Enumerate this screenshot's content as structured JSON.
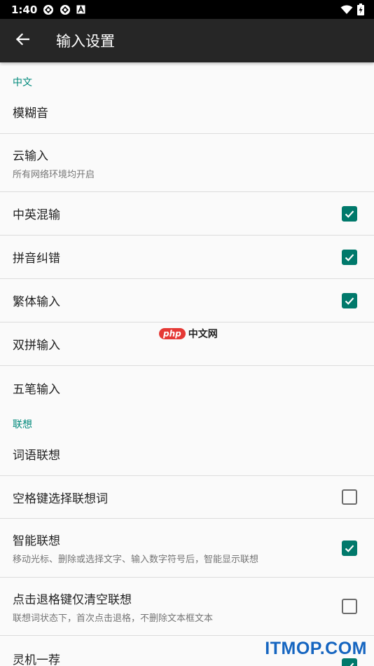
{
  "status_bar": {
    "time": "1:40",
    "icons": [
      "app-notification-icon",
      "app-notification-icon",
      "a-notification-icon",
      "wifi-icon",
      "battery-icon"
    ]
  },
  "app_bar": {
    "title": "输入设置",
    "back_icon": "arrow-back-icon"
  },
  "sections": [
    {
      "header": "中文",
      "items": [
        {
          "title": "模糊音",
          "summary": "",
          "checkbox": null
        },
        {
          "title": "云输入",
          "summary": "所有网络环境均开启",
          "checkbox": null
        },
        {
          "title": "中英混输",
          "summary": "",
          "checkbox": true
        },
        {
          "title": "拼音纠错",
          "summary": "",
          "checkbox": true
        },
        {
          "title": "繁体输入",
          "summary": "",
          "checkbox": true
        },
        {
          "title": "双拼输入",
          "summary": "",
          "checkbox": null
        },
        {
          "title": "五笔输入",
          "summary": "",
          "checkbox": null
        }
      ]
    },
    {
      "header": "联想",
      "items": [
        {
          "title": "词语联想",
          "summary": "",
          "checkbox": null
        },
        {
          "title": "空格键选择联想词",
          "summary": "",
          "checkbox": false
        },
        {
          "title": "智能联想",
          "summary": "移动光标、删除或选择文字、输入数字符号后，智能显示联想",
          "checkbox": true
        },
        {
          "title": "点击退格键仅清空联想",
          "summary": "联想词状态下，首次点击退格，不删除文本框文本",
          "checkbox": false
        },
        {
          "title": "灵机一荐",
          "summary": "",
          "checkbox": true
        }
      ]
    }
  ],
  "watermark": {
    "badge": "php",
    "text": "中文网"
  },
  "corner_watermark": "ITMOP.COM",
  "colors": {
    "accent": "#00796b",
    "section_header": "#00897b",
    "app_bar": "#262626",
    "status_bar": "#000000"
  }
}
